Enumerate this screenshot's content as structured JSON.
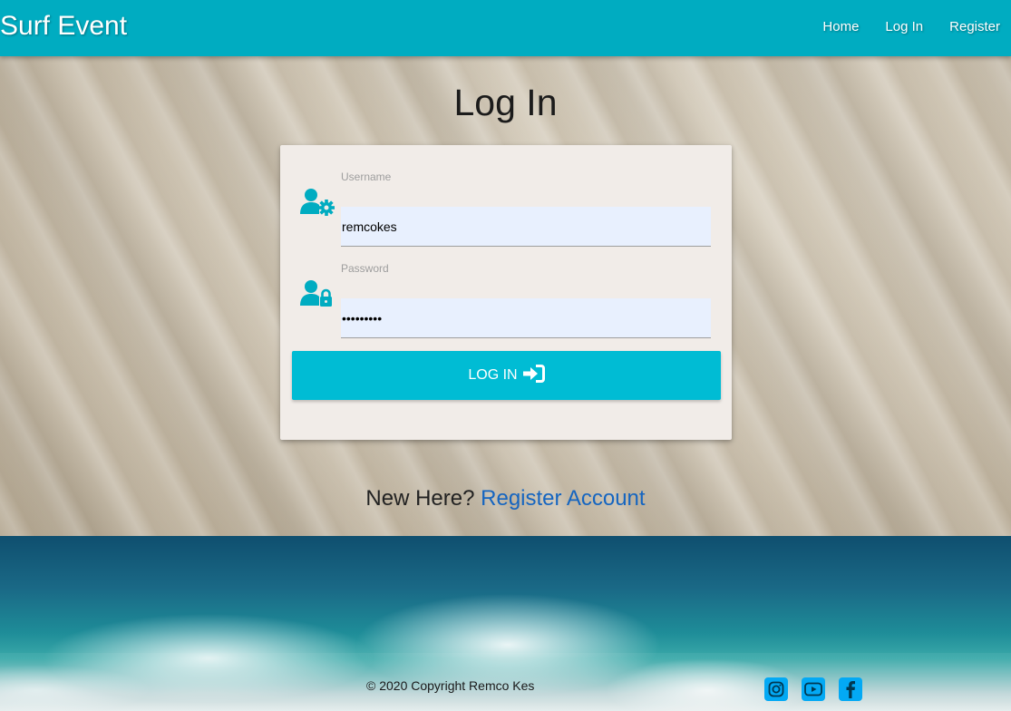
{
  "navbar": {
    "brand": "Surf Event",
    "links": [
      "Home",
      "Log In",
      "Register"
    ]
  },
  "page": {
    "title": "Log In"
  },
  "form": {
    "username": {
      "label": "Username",
      "value": "remcokes",
      "icon": "user-gear-icon"
    },
    "password": {
      "label": "Password",
      "value": "•••••••••",
      "icon": "user-lock-icon"
    },
    "submit_label": "Log In",
    "submit_icon": "sign-in-icon"
  },
  "register": {
    "prompt": "New Here?",
    "link": "Register Account"
  },
  "footer": {
    "copyright": "© 2020 Copyright Remco Kes",
    "social_icons": [
      "instagram-icon",
      "youtube-icon",
      "facebook-icon"
    ]
  },
  "colors": {
    "navbar": "#00acc1",
    "button": "#00bcd4",
    "accent_icon": "#00acc1",
    "link": "#1565c0",
    "card": "#f1ece8",
    "social": "#03a9f4"
  }
}
